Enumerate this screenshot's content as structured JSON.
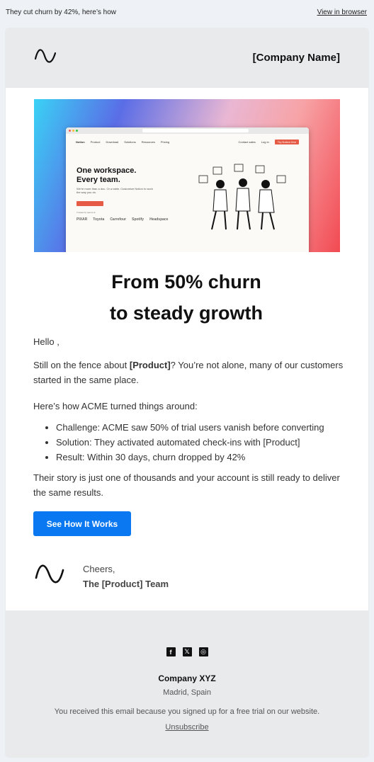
{
  "preheader": {
    "text": "They cut churn by 42%, here’s how",
    "view_in_browser": "View in browser"
  },
  "header": {
    "logo_icon": "sine-wave-icon",
    "company_name": "[Company Name]"
  },
  "hero": {
    "image_icon": "notion-website-screenshot",
    "site_headline_line1": "One workspace.",
    "site_headline_line2": "Every team.",
    "site_sub": "We're more than a doc. Or a table. Customize Notion to work the way you do.",
    "site_cta": "Try Notion free",
    "site_nav": [
      "Notion",
      "Product",
      "Download",
      "Solutions",
      "Resources",
      "Pricing",
      "Contact sales",
      "Log in"
    ],
    "site_try": "Try Notion free",
    "trusted": "Trusted by teams at",
    "logos": [
      "PIXAR",
      "Toyota",
      "Carrefour",
      "Spotify",
      "Headspace"
    ]
  },
  "headline": {
    "line1": "From 50% churn",
    "line2": "to steady growth"
  },
  "body": {
    "greeting": "Hello ,",
    "p1_pre": "Still on the fence about ",
    "p1_product": "[Product]",
    "p1_post": "? You’re not alone, many of our customers started in the same place.",
    "p2": "Here’s how ACME turned things around:",
    "bullets": [
      "Challenge: ACME saw 50% of trial users vanish before converting",
      "Solution: They activated automated check-ins with [Product]",
      "Result: Within 30 days, churn dropped by 42%"
    ],
    "p3": "Their story is just one of thousands and your account is still ready to deliver the same results."
  },
  "cta": {
    "label": "See How It Works",
    "color": "#0a78f0"
  },
  "signature": {
    "cheers": "Cheers,",
    "team": "The [Product] Team"
  },
  "footer": {
    "socials": [
      "facebook-icon",
      "x-icon",
      "instagram-icon"
    ],
    "company": "Company XYZ",
    "location": "Madrid, Spain",
    "note": "You received this email because you signed up for a free trial on our website.",
    "unsubscribe": "Unsubscribe"
  }
}
